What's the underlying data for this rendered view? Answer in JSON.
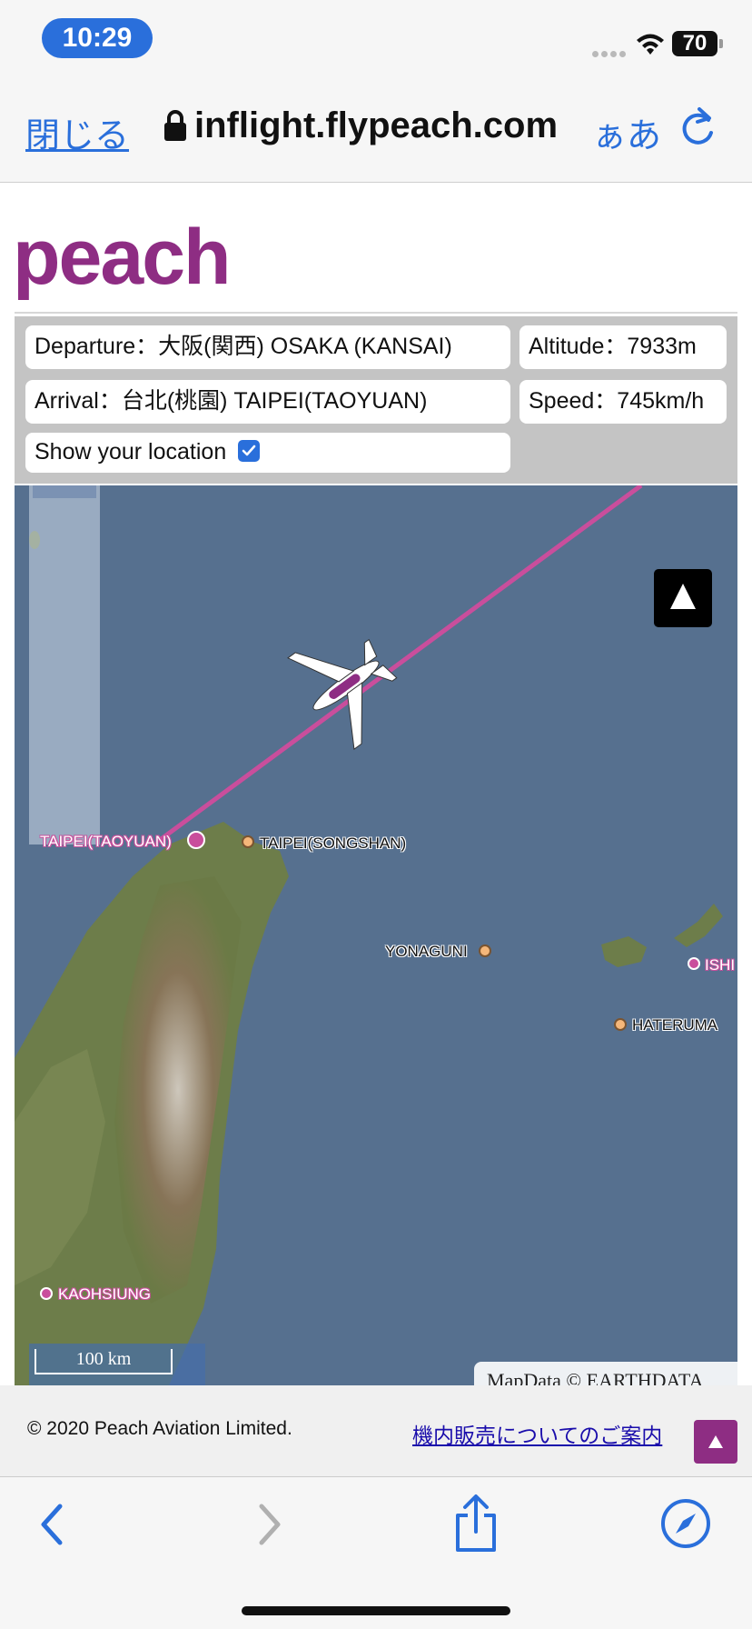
{
  "status_bar": {
    "time": "10:29",
    "battery": "70"
  },
  "browser": {
    "close_label": "閉じる",
    "url": "inflight.flypeach.com",
    "text_size_label": "ぁあ"
  },
  "logo": {
    "text": "peach"
  },
  "flight_info": {
    "departure": "Departure：大阪(関西) OSAKA (KANSAI)",
    "arrival": "Arrival：台北(桃園) TAIPEI(TAOYUAN)",
    "altitude": "Altitude：7933m",
    "speed": "Speed：745km/h",
    "show_location_label": "Show your location",
    "show_location_checked": true
  },
  "map": {
    "places": {
      "taoyuan": "TAIPEI(TAOYUAN)",
      "songshan": "TAIPEI(SONGSHAN)",
      "yonaguni": "YONAGUNI",
      "ishigaki": "ISHI",
      "hateruma": "HATERUMA",
      "kaohsiung": "KAOHSIUNG"
    },
    "scale_label": "100 km",
    "attribution": "MapData © EARTHDATA",
    "route_color": "#c94e9c"
  },
  "footer": {
    "copyright": "© 2020 Peach Aviation Limited.",
    "sales_link": "機内販売についてのご案内"
  },
  "colors": {
    "brand": "#8e2d83",
    "ios_blue": "#2a6fdb",
    "sea": "#56708f"
  }
}
